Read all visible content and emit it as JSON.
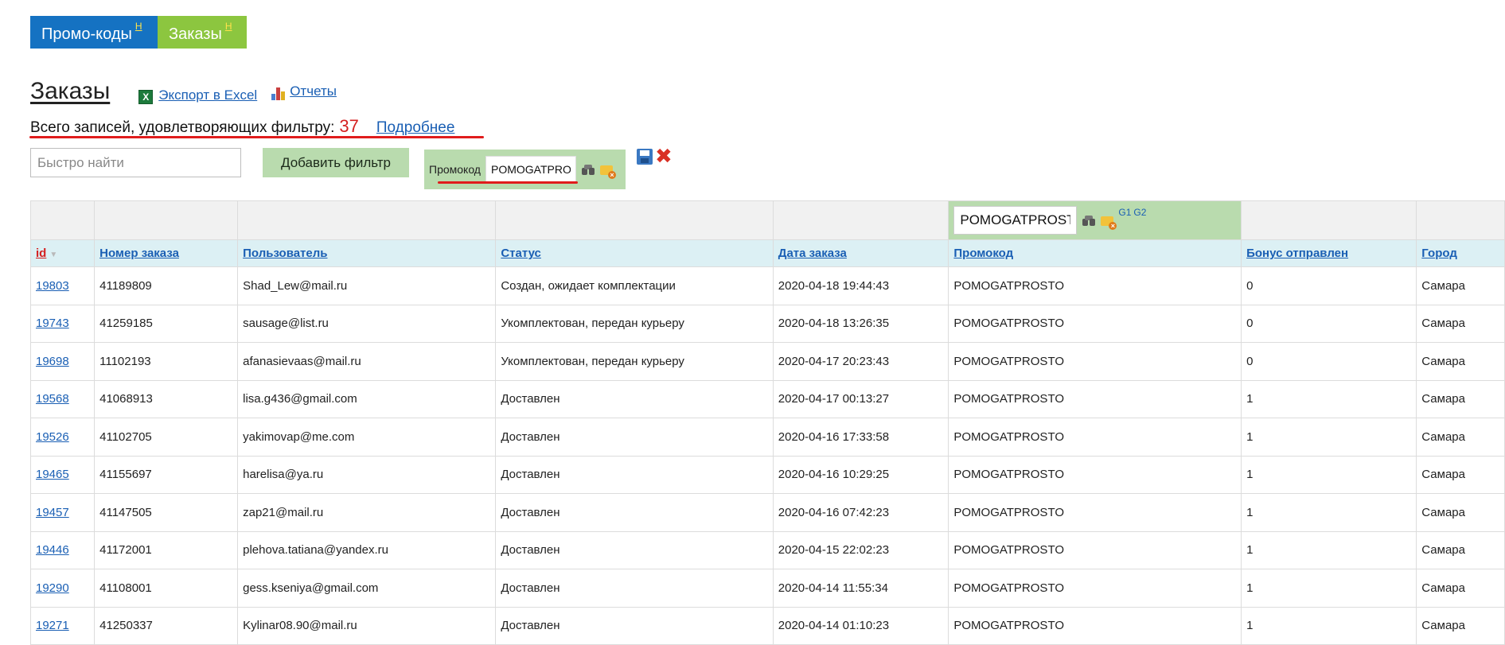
{
  "tabs": [
    {
      "label": "Промо-коды",
      "badge": "Н"
    },
    {
      "label": "Заказы",
      "badge": "Н"
    }
  ],
  "header": {
    "title": "Заказы",
    "export_label": "Экспорт в Excel",
    "excel_icon_glyph": "X",
    "reports_label": "Отчеты"
  },
  "summary": {
    "text": "Всего записей, удовлетворяющих фильтру:",
    "count": "37",
    "details_link": "Подробнее"
  },
  "filters": {
    "quick_search_placeholder": "Быстро найти",
    "add_filter_label": "Добавить фильтр",
    "chip_label": "Промокод",
    "chip_value": "POMOGATPROSTO",
    "column_filter_value": "POMOGATPROSTO",
    "g1": "G1",
    "g2": "G2"
  },
  "table": {
    "columns": [
      {
        "key": "id",
        "label": "id",
        "sorted": true
      },
      {
        "key": "order",
        "label": "Номер заказа"
      },
      {
        "key": "user",
        "label": "Пользователь"
      },
      {
        "key": "status",
        "label": "Статус"
      },
      {
        "key": "date",
        "label": "Дата заказа"
      },
      {
        "key": "promo",
        "label": "Промокод"
      },
      {
        "key": "bonus",
        "label": "Бонус отправлен"
      },
      {
        "key": "city",
        "label": "Город"
      }
    ],
    "rows": [
      [
        "19803",
        "41189809",
        "Shad_Lew@mail.ru",
        "Создан, ожидает комплектации",
        "2020-04-18 19:44:43",
        "POMOGATPROSTO",
        "0",
        "Самара"
      ],
      [
        "19743",
        "41259185",
        "sausage@list.ru",
        "Укомплектован, передан курьеру",
        "2020-04-18 13:26:35",
        "POMOGATPROSTO",
        "0",
        "Самара"
      ],
      [
        "19698",
        "11102193",
        "afanasievaas@mail.ru",
        "Укомплектован, передан курьеру",
        "2020-04-17 20:23:43",
        "POMOGATPROSTO",
        "0",
        "Самара"
      ],
      [
        "19568",
        "41068913",
        "lisa.g436@gmail.com",
        "Доставлен",
        "2020-04-17 00:13:27",
        "POMOGATPROSTO",
        "1",
        "Самара"
      ],
      [
        "19526",
        "41102705",
        "yakimovap@me.com",
        "Доставлен",
        "2020-04-16 17:33:58",
        "POMOGATPROSTO",
        "1",
        "Самара"
      ],
      [
        "19465",
        "41155697",
        "harelisa@ya.ru",
        "Доставлен",
        "2020-04-16 10:29:25",
        "POMOGATPROSTO",
        "1",
        "Самара"
      ],
      [
        "19457",
        "41147505",
        "zap21@mail.ru",
        "Доставлен",
        "2020-04-16 07:42:23",
        "POMOGATPROSTO",
        "1",
        "Самара"
      ],
      [
        "19446",
        "41172001",
        "plehova.tatiana@yandex.ru",
        "Доставлен",
        "2020-04-15 22:02:23",
        "POMOGATPROSTO",
        "1",
        "Самара"
      ],
      [
        "19290",
        "41108001",
        "gess.kseniya@gmail.com",
        "Доставлен",
        "2020-04-14 11:55:34",
        "POMOGATPROSTO",
        "1",
        "Самара"
      ],
      [
        "19271",
        "41250337",
        "Kylinar08.90@mail.ru",
        "Доставлен",
        "2020-04-14 01:10:23",
        "POMOGATPROSTO",
        "1",
        "Самара"
      ]
    ]
  },
  "colors": {
    "tab_blue": "#1572c2",
    "tab_green": "#8cc63f",
    "filter_green": "#b9dbae",
    "header_row": "#dcf0f4",
    "highlight_red": "#e01c1c"
  }
}
